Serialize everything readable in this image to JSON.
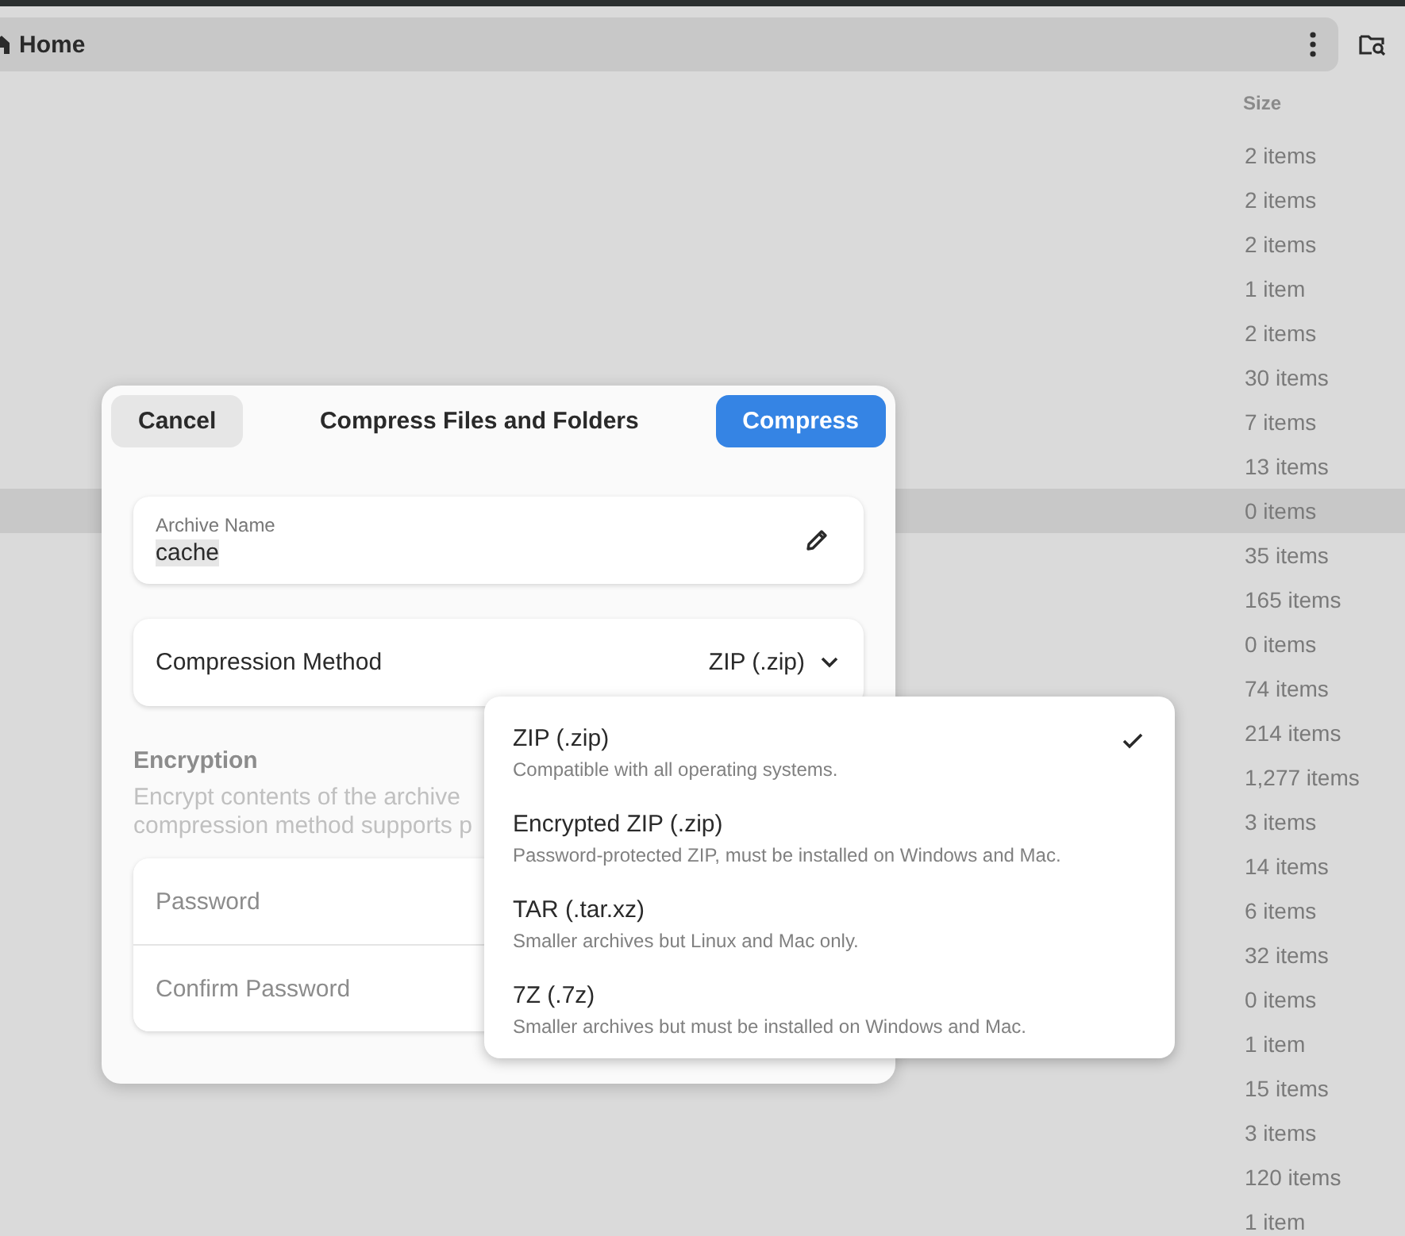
{
  "path_bar": {
    "label": "Home"
  },
  "columns": [
    {
      "label": "Size"
    }
  ],
  "rows": [
    {
      "size": "2 items",
      "selected": false
    },
    {
      "size": "2 items",
      "selected": false
    },
    {
      "size": "2 items",
      "selected": false
    },
    {
      "size": "1 item",
      "selected": false
    },
    {
      "size": "2 items",
      "selected": false
    },
    {
      "size": "30 items",
      "selected": false
    },
    {
      "size": "7 items",
      "selected": false
    },
    {
      "size": "13 items",
      "selected": false
    },
    {
      "size": "0 items",
      "selected": true
    },
    {
      "size": "35 items",
      "selected": false
    },
    {
      "size": "165 items",
      "selected": false
    },
    {
      "size": "0 items",
      "selected": false
    },
    {
      "size": "74 items",
      "selected": false
    },
    {
      "size": "214 items",
      "selected": false
    },
    {
      "size": "1,277 items",
      "selected": false
    },
    {
      "size": "3 items",
      "selected": false
    },
    {
      "size": "14 items",
      "selected": false
    },
    {
      "size": "6 items",
      "selected": false
    },
    {
      "size": "32 items",
      "selected": false
    },
    {
      "size": "0 items",
      "selected": false
    },
    {
      "size": "1 item",
      "selected": false
    },
    {
      "size": "15 items",
      "selected": false
    },
    {
      "size": "3 items",
      "selected": false
    },
    {
      "size": "120 items",
      "selected": false
    },
    {
      "size": "1 item",
      "selected": false
    }
  ],
  "dialog": {
    "title": "Compress Files and Folders",
    "cancel": "Cancel",
    "confirm": "Compress",
    "archive_name": {
      "label": "Archive Name",
      "value": "cache"
    },
    "method": {
      "label": "Compression Method",
      "value": "ZIP (.zip)"
    },
    "encryption": {
      "title": "Encryption",
      "description": "Encrypt contents of the archive\ncompression method supports p"
    },
    "password": {
      "placeholder": "Password"
    },
    "confirm_password": {
      "placeholder": "Confirm Password"
    }
  },
  "method_menu": [
    {
      "name": "ZIP (.zip)",
      "description": "Compatible with all operating systems.",
      "selected": true
    },
    {
      "name": "Encrypted ZIP (.zip)",
      "description": "Password-protected ZIP, must be installed on Windows and Mac.",
      "selected": false
    },
    {
      "name": "TAR (.tar.xz)",
      "description": "Smaller archives but Linux and Mac only.",
      "selected": false
    },
    {
      "name": "7Z (.7z)",
      "description": "Smaller archives but must be installed on Windows and Mac.",
      "selected": false
    }
  ]
}
